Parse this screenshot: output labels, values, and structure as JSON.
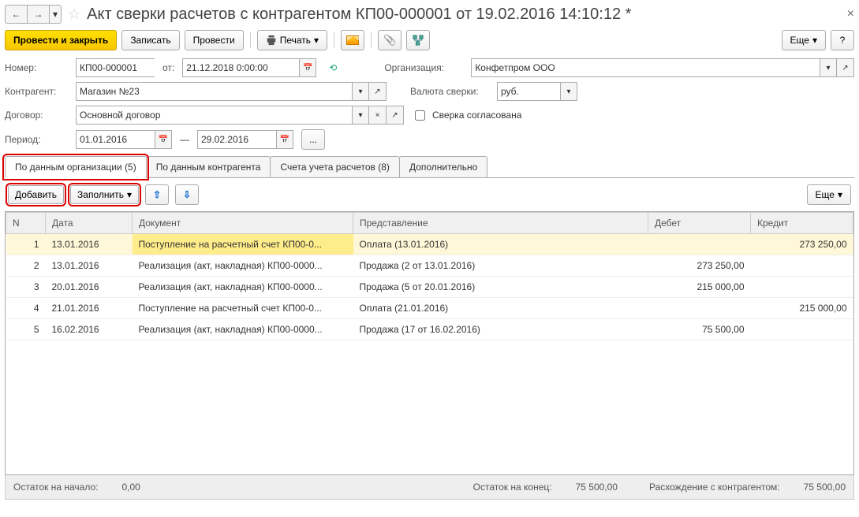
{
  "title": "Акт сверки расчетов с контрагентом КП00-000001 от 19.02.2016 14:10:12 *",
  "toolbar": {
    "post_close": "Провести и закрыть",
    "save": "Записать",
    "post": "Провести",
    "print": "Печать",
    "more": "Еще",
    "help": "?"
  },
  "form": {
    "number_label": "Номер:",
    "number": "КП00-000001",
    "from_label": "от:",
    "from_date": "21.12.2018  0:00:00",
    "org_label": "Организация:",
    "org": "Конфетпром ООО",
    "contr_label": "Контрагент:",
    "contr": "Магазин №23",
    "currency_label": "Валюта сверки:",
    "currency": "руб.",
    "contract_label": "Договор:",
    "contract": "Основной договор",
    "agreed_label": "Сверка согласована",
    "period_label": "Период:",
    "period_from": "01.01.2016",
    "period_to": "29.02.2016",
    "dash": "—"
  },
  "tabs": {
    "org": "По данным организации (5)",
    "contr": "По данным контрагента",
    "accounts": "Счета учета расчетов (8)",
    "extra": "Дополнительно"
  },
  "subtool": {
    "add": "Добавить",
    "fill": "Заполнить",
    "more": "Еще"
  },
  "columns": {
    "n": "N",
    "date": "Дата",
    "doc": "Документ",
    "repr": "Представление",
    "debit": "Дебет",
    "credit": "Кредит"
  },
  "rows": [
    {
      "n": "1",
      "date": "13.01.2016",
      "doc": "Поступление на расчетный счет КП00-0...",
      "repr": "Оплата (13.01.2016)",
      "debit": "",
      "credit": "273 250,00"
    },
    {
      "n": "2",
      "date": "13.01.2016",
      "doc": "Реализация (акт, накладная) КП00-0000...",
      "repr": "Продажа (2 от 13.01.2016)",
      "debit": "273 250,00",
      "credit": ""
    },
    {
      "n": "3",
      "date": "20.01.2016",
      "doc": "Реализация (акт, накладная) КП00-0000...",
      "repr": "Продажа (5 от 20.01.2016)",
      "debit": "215 000,00",
      "credit": ""
    },
    {
      "n": "4",
      "date": "21.01.2016",
      "doc": "Поступление на расчетный счет КП00-0...",
      "repr": "Оплата (21.01.2016)",
      "debit": "",
      "credit": "215 000,00"
    },
    {
      "n": "5",
      "date": "16.02.2016",
      "doc": "Реализация (акт, накладная) КП00-0000...",
      "repr": "Продажа (17 от 16.02.2016)",
      "debit": "75 500,00",
      "credit": ""
    }
  ],
  "footer": {
    "start_label": "Остаток на начало:",
    "start_val": "0,00",
    "end_label": "Остаток на конец:",
    "end_val": "75 500,00",
    "diff_label": "Расхождение с контрагентом:",
    "diff_val": "75 500,00"
  }
}
